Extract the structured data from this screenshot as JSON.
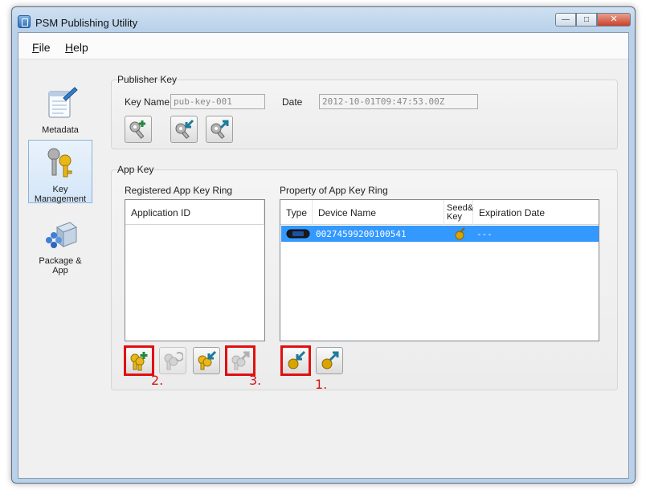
{
  "window": {
    "title": "PSM Publishing Utility"
  },
  "menu": {
    "file": {
      "accel": "F",
      "rest": "ile"
    },
    "help": {
      "accel": "H",
      "rest": "elp"
    }
  },
  "nav": [
    {
      "label": "Metadata",
      "icon": "notepad-pen-icon"
    },
    {
      "label": "Key\nManagement",
      "icon": "key-ring-icon",
      "active": true
    },
    {
      "label": "Package &\nApp",
      "icon": "package-icon"
    }
  ],
  "publisher_key": {
    "group_title": "Publisher Key",
    "key_name_label": "Key Name",
    "key_name_value": "pub-key-001",
    "date_label": "Date",
    "date_value": "2012-10-01T09:47:53.00Z"
  },
  "app_key": {
    "group_title": "App Key",
    "registered_label": "Registered App Key Ring",
    "registered_columns": [
      "Application ID"
    ],
    "property_label": "Property of App Key Ring",
    "property_columns": [
      "Type",
      "Device Name",
      "Seed&\nKey",
      "Expiration Date"
    ],
    "rows": [
      {
        "device_name": "00274599200100541",
        "expiration": "---",
        "selected": true
      }
    ]
  },
  "annotations": [
    "1.",
    "2.",
    "3."
  ],
  "colors": {
    "highlight": "#e01010",
    "selection": "#3399ff",
    "key_gold": "#d9a400",
    "arrow_teal": "#1e7a9a"
  }
}
